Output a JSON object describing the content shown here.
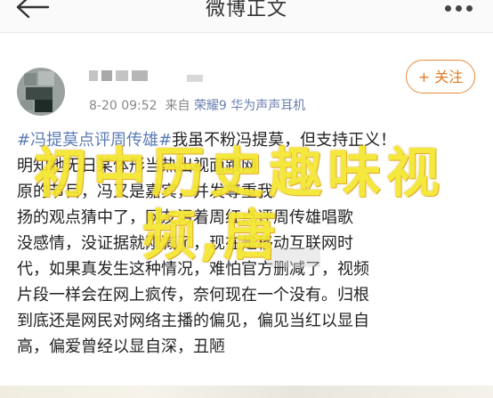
{
  "header": {
    "title": "微博正文",
    "back_icon": "arrow-left-icon",
    "more_icon": "more-dots-icon"
  },
  "author": {
    "time": "8-20 09:52",
    "source_prefix": "来自",
    "device": "荣耀9 华为声声耳机"
  },
  "follow": {
    "label": "+ 关注",
    "color": "#e07a22"
  },
  "post": {
    "hashtag": "#冯提莫点评周传雄#",
    "lines": [
      "我虽不粉冯提莫，但支持正义！",
      "明知她无日某体形当热出视面跟网",
      "原的节目，冯又是嘉宾，并发尊重我",
      "扬的观点猜中了，网友污着周红点评周传雄唱歌",
      "没感情，没证据就刚减了，现在是移动互联网时",
      "代，如果真发生这种情况，难怕官方删减了，视频",
      "片段一样会在网上疯传，奈何现在一个没有。归根",
      "到底还是网民对网络主播的偏见，偏见当红以显自",
      "高，偏爱曾经以显自深，丑陋"
    ]
  },
  "overlay": {
    "line1": "初中历史趣味视",
    "line2": "频,唐",
    "color": "#f4e72e"
  }
}
